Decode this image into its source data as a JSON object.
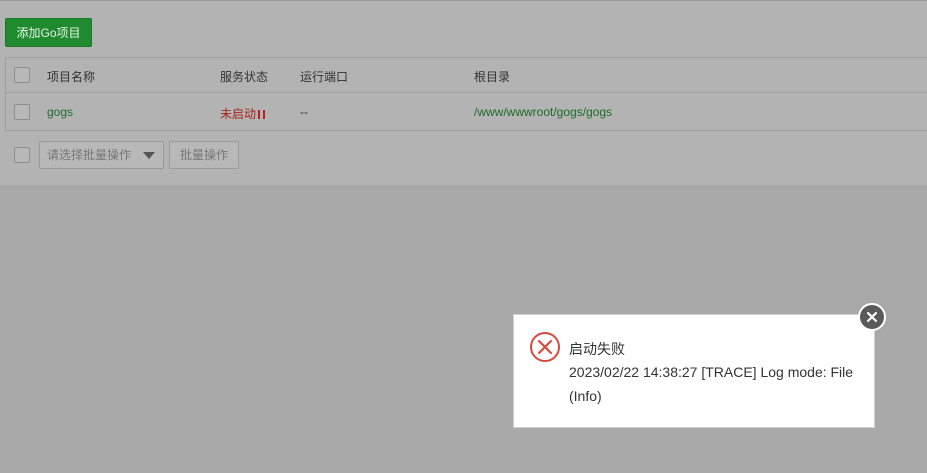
{
  "toolbar": {
    "add_button": "添加Go项目"
  },
  "table": {
    "headers": {
      "name": "项目名称",
      "status": "服务状态",
      "port": "运行端口",
      "root": "根目录"
    },
    "rows": [
      {
        "name": "gogs",
        "status": "未启动",
        "port": "--",
        "root": "/www/wwwroot/gogs/gogs"
      }
    ]
  },
  "batch": {
    "select_placeholder": "请选择批量操作",
    "button": "批量操作"
  },
  "toast": {
    "title": "启动失败",
    "message": "2023/02/22 14:38:27 [TRACE] Log mode: File (Info)"
  },
  "colors": {
    "accent": "#1f8a2e",
    "error": "#d9493b",
    "link": "#1d6b2a"
  }
}
